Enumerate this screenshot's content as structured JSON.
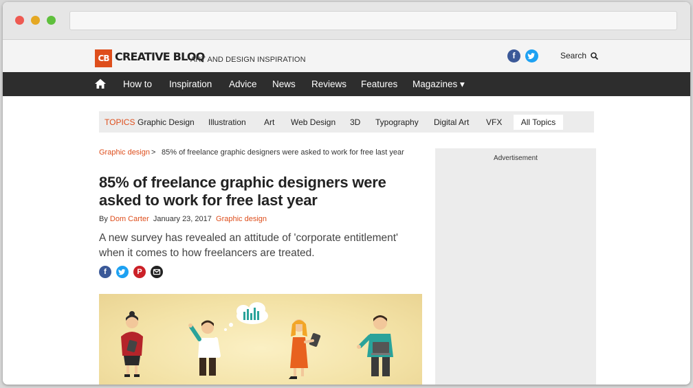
{
  "site": {
    "logo_badge": "CB",
    "logo_text": "CREATIVE BLOQ",
    "tagline": "ART AND DESIGN INSPIRATION",
    "search_label": "Search",
    "brand_color": "#de4e1c"
  },
  "nav": {
    "items": [
      "How to",
      "Inspiration",
      "Advice",
      "News",
      "Reviews",
      "Features",
      "Magazines ▾"
    ]
  },
  "topics": {
    "label": "TOPICS",
    "items": [
      "Graphic Design",
      "Illustration",
      "Art",
      "Web Design",
      "3D",
      "Typography",
      "Digital Art",
      "VFX"
    ],
    "all_label": "All Topics"
  },
  "article": {
    "breadcrumb_link": "Graphic design",
    "breadcrumb_sep": ">",
    "breadcrumb_current": "85% of freelance graphic designers were asked to work for free last year",
    "headline": "85% of freelance graphic designers were asked to work for free last year",
    "by_prefix": "By",
    "author": "Dom Carter",
    "date": "January 23, 2017",
    "category": "Graphic design",
    "standfirst": "A new survey has revealed an attitude of 'corporate entitlement' when it comes to how freelancers are treated."
  },
  "ad": {
    "label": "Advertisement"
  },
  "icons": {
    "facebook": "facebook-icon",
    "twitter": "twitter-icon",
    "pinterest": "pinterest-icon",
    "email": "email-icon",
    "search": "search-icon",
    "home": "home-icon"
  }
}
